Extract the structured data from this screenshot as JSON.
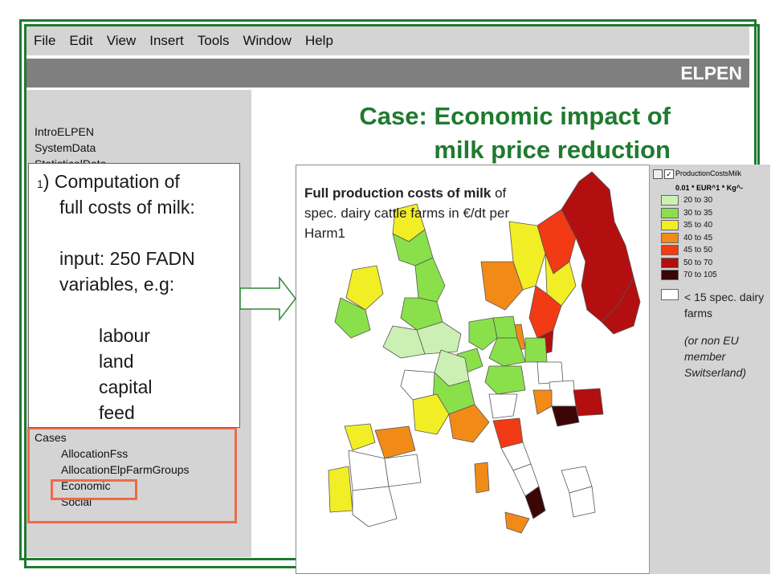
{
  "menu": [
    "File",
    "Edit",
    "View",
    "Insert",
    "Tools",
    "Window",
    "Help"
  ],
  "brand": "ELPEN",
  "nav": {
    "top_items": [
      "IntroELPEN",
      "SystemData",
      "StatisticalData"
    ],
    "cases_label": "Cases",
    "cases_items": [
      "AllocationFss",
      "AllocationElpFarmGroups",
      "Economic",
      "Social"
    ]
  },
  "heading": {
    "line1": "Case: Economic impact of",
    "line2": "milk price reduction"
  },
  "callout": {
    "number": "1",
    "title_line1": ") Computation of",
    "title_line2": "full costs of milk:",
    "input_line1": "input: 250 FADN",
    "input_line2": "variables, e.g:",
    "examples": [
      "labour",
      "land",
      "capital",
      "feed"
    ]
  },
  "map": {
    "caption_bold": "Full production costs of milk",
    "caption_rest": " of spec. dairy cattle farms in €/dt per Harm1",
    "legend": {
      "layer_name": "ProductionCostsMilk",
      "unit": "0.01 * EUR^1 * Kg^-",
      "classes": [
        {
          "label": "20 to 30",
          "color": "#ccf0b4"
        },
        {
          "label": "30 to 35",
          "color": "#8ae04a"
        },
        {
          "label": "35 to 40",
          "color": "#f2ee26"
        },
        {
          "label": "40 to 45",
          "color": "#f28a18"
        },
        {
          "label": "45 to 50",
          "color": "#f23a14"
        },
        {
          "label": "50 to 70",
          "color": "#b30e10"
        },
        {
          "label": "70 to 105",
          "color": "#3a0606"
        }
      ]
    },
    "note": "< 15 spec. dairy farms",
    "note_italic": "(or non EU member Switserland)"
  },
  "colors": {
    "frame": "#1f7a2e",
    "heading": "#1f7a2e",
    "highlight": "#ee6a4a"
  }
}
